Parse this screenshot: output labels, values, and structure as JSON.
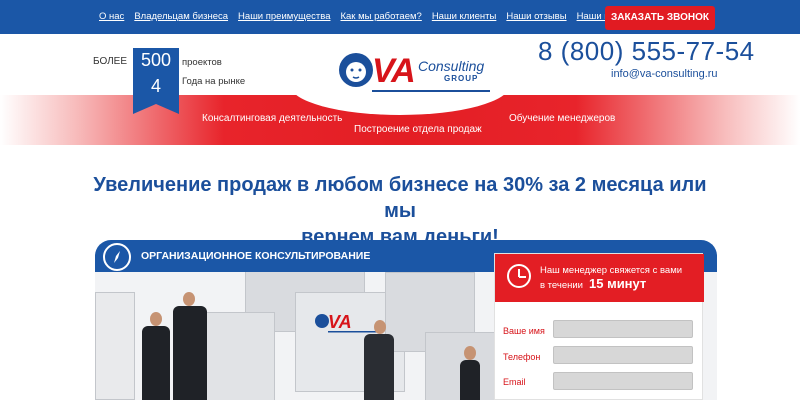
{
  "nav": {
    "items": [
      "О нас",
      "Владельцам бизнеса",
      "Наши преимущества",
      "Как мы работаем?",
      "Наши клиенты",
      "Наши отзывы",
      "Наши контакты"
    ],
    "call_button": "ЗАКАЗАТЬ ЗВОНОК"
  },
  "header": {
    "bolee": "БОЛЕЕ",
    "projects_count": "500",
    "projects_label": "проектов",
    "years_count": "4",
    "years_label": "Года на рынке",
    "logo": {
      "va": "VA",
      "consulting": "Consulting",
      "group": "GROUP"
    },
    "phone": "8 (800) 555-77-54",
    "email": "info@va-consulting.ru"
  },
  "sub_nav": [
    "Консалтинговая деятельность",
    "Построение отдела продаж",
    "Обучение менеджеров"
  ],
  "headline": {
    "line1": "Увеличение продаж в любом бизнесе на 30% за 2 месяца или мы",
    "line2": "вернем вам деньги!"
  },
  "section": {
    "title": "ОРГАНИЗАЦИОННОЕ КОНСУЛЬТИРОВАНИЕ"
  },
  "form": {
    "line1": "Наш менеджер свяжется с вами",
    "line2": "в течении",
    "line2_bold": "15 минут",
    "fields": [
      {
        "label": "Ваше имя",
        "value": ""
      },
      {
        "label": "Телефон",
        "value": ""
      },
      {
        "label": "Email",
        "value": ""
      }
    ]
  },
  "colors": {
    "brand_blue": "#1b57a7",
    "brand_red": "#e31e24"
  }
}
